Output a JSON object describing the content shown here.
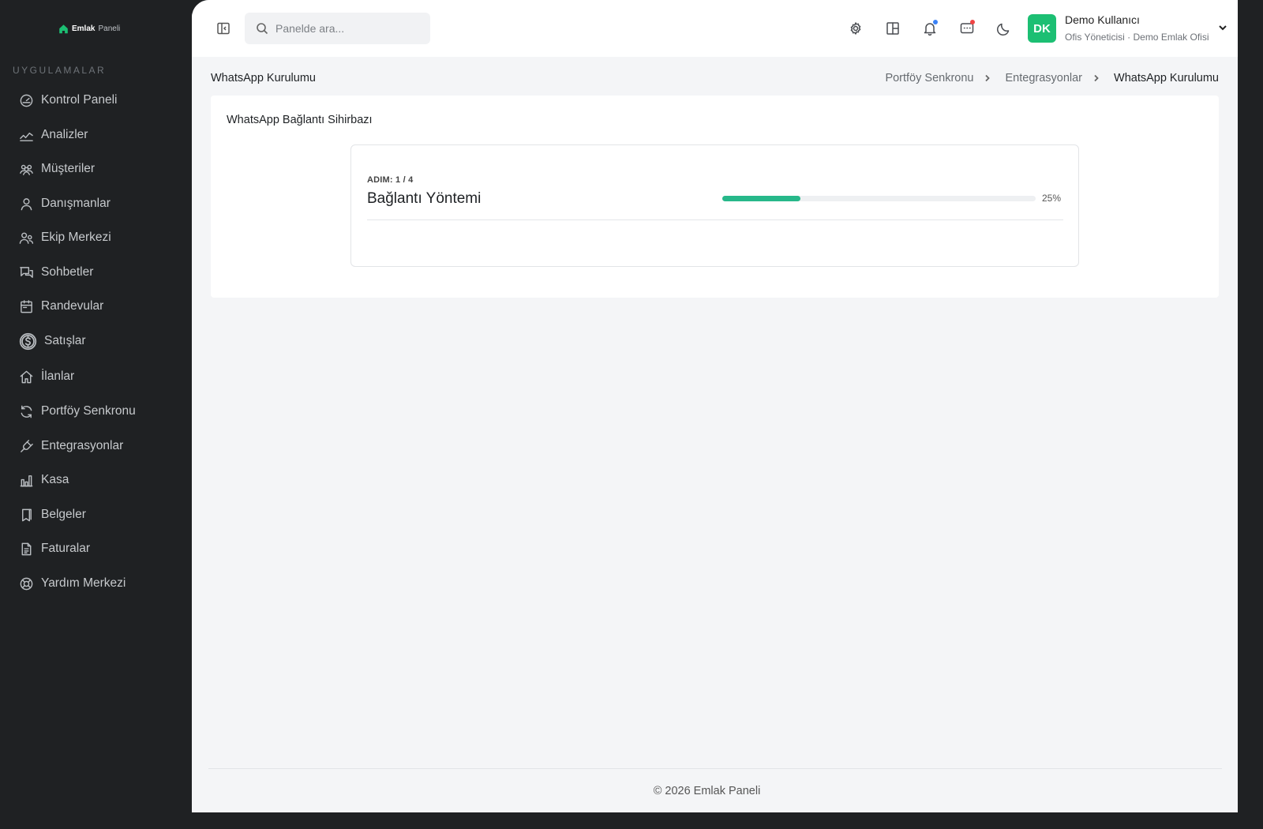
{
  "brand": {
    "name_bold": "Emlak",
    "name_light": "Paneli",
    "color": "#1cbf73"
  },
  "sidebar": {
    "section_label": "UYGULAMALAR",
    "items": [
      {
        "label": "Kontrol Paneli",
        "icon": "dashboard-gauge-icon"
      },
      {
        "label": "Analizler",
        "icon": "analytics-chart-icon"
      },
      {
        "label": "Müşteriler",
        "icon": "customers-group-icon"
      },
      {
        "label": "Danışmanlar",
        "icon": "consultant-user-icon"
      },
      {
        "label": "Ekip Merkezi",
        "icon": "team-users-icon"
      },
      {
        "label": "Sohbetler",
        "icon": "chat-bubbles-icon"
      },
      {
        "label": "Randevular",
        "icon": "calendar-icon"
      },
      {
        "label": "Satışlar",
        "icon": "dollar-coin-icon"
      },
      {
        "label": "İlanlar",
        "icon": "home-icon"
      },
      {
        "label": "Portföy Senkronu",
        "icon": "sync-icon"
      },
      {
        "label": "Entegrasyonlar",
        "icon": "plug-icon"
      },
      {
        "label": "Kasa",
        "icon": "bar-chart-icon"
      },
      {
        "label": "Belgeler",
        "icon": "documents-icon"
      },
      {
        "label": "Faturalar",
        "icon": "invoice-icon"
      },
      {
        "label": "Yardım Merkezi",
        "icon": "help-lifebuoy-icon"
      }
    ]
  },
  "topbar": {
    "search_placeholder": "Panelde ara...",
    "icons": [
      "collapse-sidebar-icon",
      "settings-gear-icon",
      "layout-grid-icon",
      "notification-bell-icon",
      "messages-icon",
      "dark-mode-moon-icon"
    ],
    "notification_dot_color": "#3b82f6",
    "message_dot_color": "#ef4444"
  },
  "user": {
    "initials": "DK",
    "name": "Demo Kullanıcı",
    "role": "Ofis Yöneticisi · Demo Emlak Ofisi"
  },
  "page": {
    "title": "WhatsApp Kurulumu",
    "breadcrumbs": [
      "Portföy Senkronu",
      "Entegrasyonlar",
      "WhatsApp Kurulumu"
    ]
  },
  "wizard": {
    "card_title": "WhatsApp Bağlantı Sihirbazı",
    "step_label": "ADIM: 1 / 4",
    "step_title": "Bağlantı Yöntemi",
    "progress_percent": 25,
    "progress_label": "25%",
    "progress_color": "#27b88a"
  },
  "footer": {
    "text": "© 2026 Emlak Paneli"
  }
}
